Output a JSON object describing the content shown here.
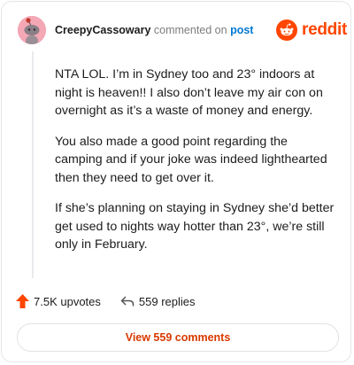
{
  "comment": {
    "username": "CreepyCassowary",
    "action_text": "commented on",
    "post_link": "post",
    "body": [
      "NTA LOL. I’m in Sydney too and 23° indoors at night is heaven!! I also don’t leave my air con on overnight as it’s a waste of money and energy.",
      "You also made a good point regarding the camping and if your joke was indeed lighthearted then they need to get over it.",
      "If she’s planning on staying in Sydney she’d better get used to nights way hotter than 23°, we’re still only in February."
    ],
    "upvotes": "7.5K upvotes",
    "replies": "559 replies",
    "view_comments": "View 559 comments"
  },
  "brand": {
    "name": "reddit",
    "color": "#ff4500"
  },
  "icons": {
    "avatar": "snoo-avatar",
    "upvote": "upvote-arrow-icon",
    "reply": "reply-arrow-icon"
  },
  "colors": {
    "accent": "#ff4500",
    "link": "#0079d3",
    "view_button_text": "#d93900",
    "avatar_bg": "#f4a7b5"
  }
}
